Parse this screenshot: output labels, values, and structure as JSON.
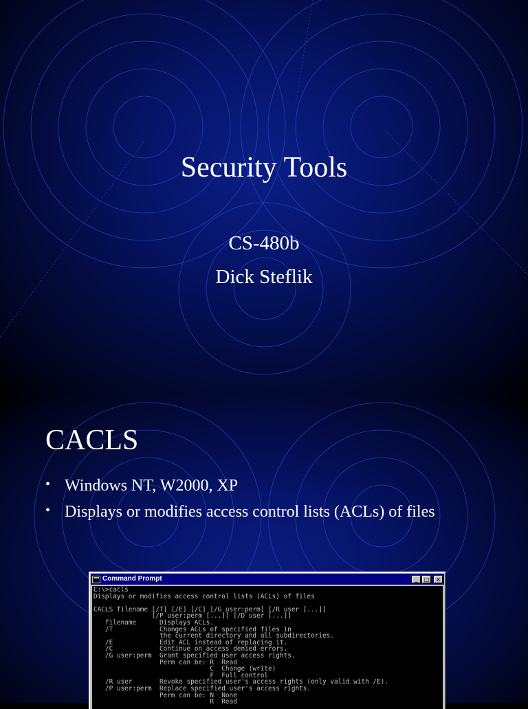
{
  "slide1": {
    "title": "Security Tools",
    "course": "CS-480b",
    "author": "Dick Steflik"
  },
  "slide2": {
    "heading": "CACLS",
    "bullets": [
      "Windows NT, W2000, XP",
      "Displays or modifies access control lists (ACLs) of files"
    ],
    "bullet_glyph": "•",
    "window": {
      "title": "Command Prompt",
      "buttons": {
        "minimize": "_",
        "maximize": "□",
        "close": "×"
      },
      "lines": [
        "C:\\>cacls",
        "Displays or modifies access control lists (ACLs) of files",
        "",
        "CACLS filename [/T] [/E] [/C] [/G user:perm] [/R user [...]]",
        "               [/P user:perm [...]] [/D user [...]]",
        "   filename      Displays ACLs.",
        "   /T            Changes ACLs of specified files in",
        "                 the current directory and all subdirectories.",
        "   /E            Edit ACL instead of replacing it.",
        "   /C            Continue on access denied errors.",
        "   /G user:perm  Grant specified user access rights.",
        "                 Perm can be: R  Read",
        "                              C  Change (write)",
        "                              F  Full control",
        "   /R user       Revoke specified user's access rights (only valid with /E).",
        "   /P user:perm  Replace specified user's access rights.",
        "                 Perm can be: N  None",
        "                              R  Read"
      ]
    }
  },
  "colors": {
    "background_center": "#0b1f86",
    "background_edge": "#000000",
    "text": "#ffffff",
    "ring_stroke": "#2a4bd0",
    "titlebar": "#000080",
    "console_bg": "#000000",
    "console_text": "#c0c0c0"
  }
}
